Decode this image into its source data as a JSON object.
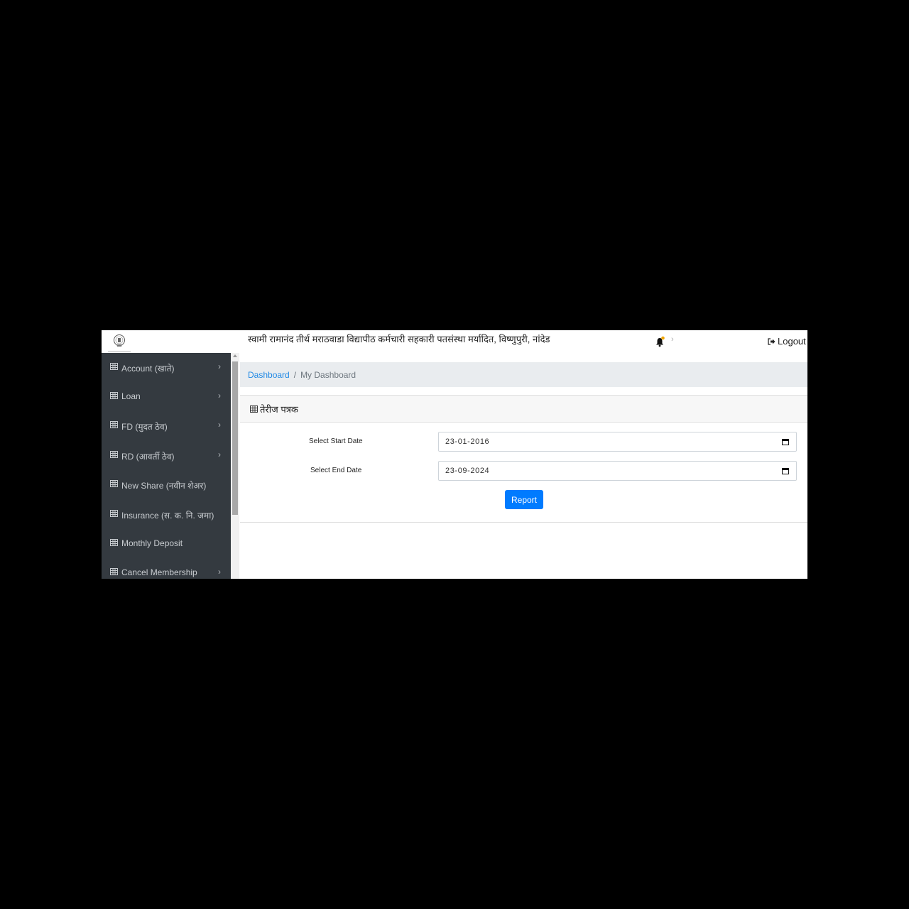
{
  "header": {
    "org_title": "स्वामी रामानंद तीर्थ मराठवाडा विद्यापीठ कर्मचारी सहकारी पतसंस्था मर्यादित, विष्णुपुरी, नांदेड",
    "logout_label": "Logout",
    "notification_dot_color": "#f0a500"
  },
  "sidebar": {
    "items": [
      {
        "label": "Account (खाते)",
        "has_submenu": true
      },
      {
        "label": "Loan",
        "has_submenu": true
      },
      {
        "label": "FD (मुदत ठेव)",
        "has_submenu": true
      },
      {
        "label": "RD (आवर्ती ठेव)",
        "has_submenu": true
      },
      {
        "label": "New Share (नवीन शेअर)",
        "has_submenu": false
      },
      {
        "label": "Insurance (स. क. नि. जमा)",
        "has_submenu": false
      },
      {
        "label": "Monthly Deposit",
        "has_submenu": false
      },
      {
        "label": "Cancel Membership",
        "has_submenu": true
      }
    ],
    "chevron": "›"
  },
  "breadcrumb": {
    "link": "Dashboard",
    "separator": "/",
    "current": "My Dashboard"
  },
  "card": {
    "title": "तेरीज पत्रक",
    "start_label": "Select Start Date",
    "start_value": "23-01-2016",
    "end_label": "Select End Date",
    "end_value": "23-09-2024",
    "button_label": "Report"
  },
  "colors": {
    "sidebar_bg": "#343a40",
    "primary": "#007bff",
    "link": "#1e88e5"
  }
}
